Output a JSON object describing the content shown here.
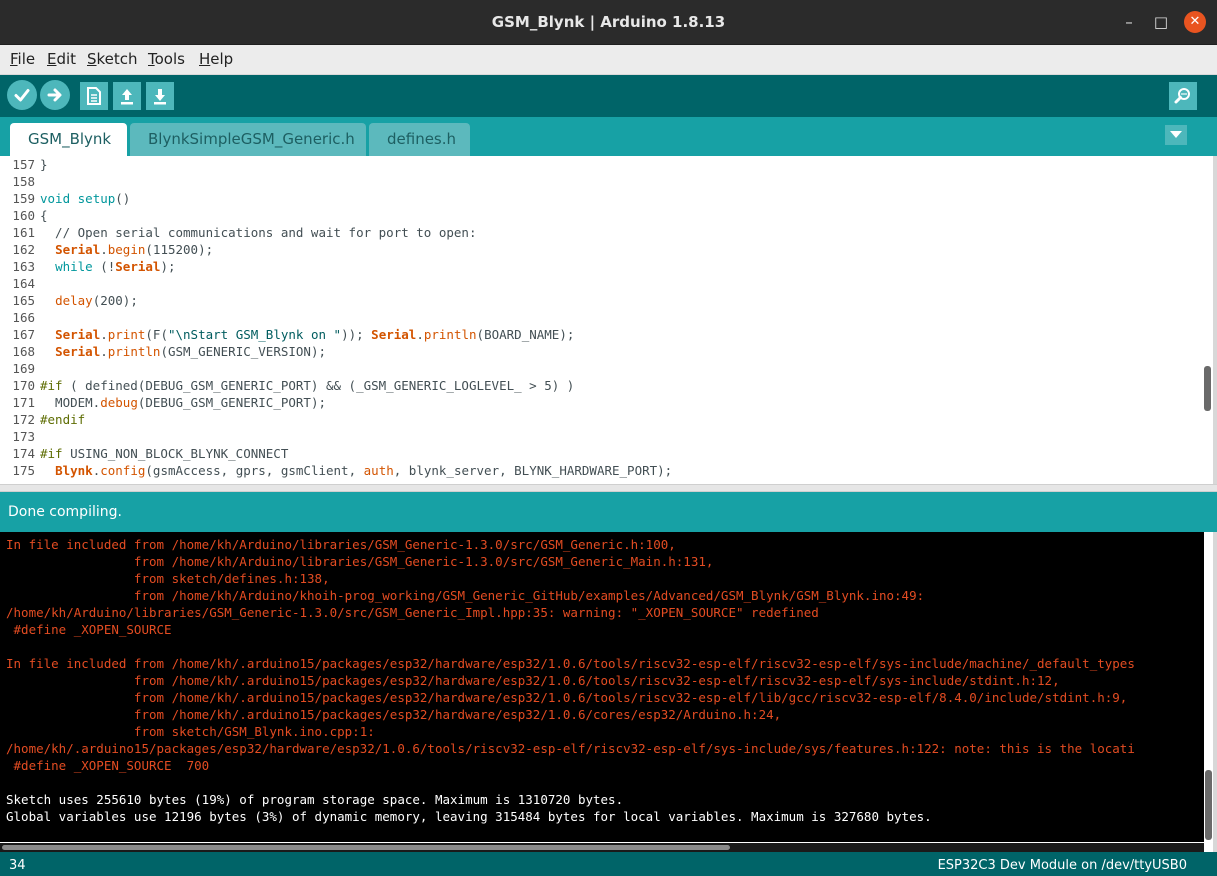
{
  "window": {
    "title": "GSM_Blynk | Arduino 1.8.13",
    "controls": {
      "minimize": "–",
      "maximize": "□",
      "close": "✕"
    }
  },
  "menu": [
    {
      "mnemonic": "F",
      "rest": "ile"
    },
    {
      "mnemonic": "E",
      "rest": "dit"
    },
    {
      "mnemonic": "S",
      "rest": "ketch"
    },
    {
      "mnemonic": "T",
      "rest": "ools"
    },
    {
      "mnemonic": "H",
      "rest": "elp"
    }
  ],
  "toolbar": {
    "buttons": [
      "verify-icon",
      "upload-icon",
      "new-icon",
      "open-icon",
      "save-icon"
    ],
    "right": "serial-monitor-icon"
  },
  "tabs": [
    {
      "label": "GSM_Blynk",
      "active": true
    },
    {
      "label": "BlynkSimpleGSM_Generic.h",
      "active": false
    },
    {
      "label": "defines.h",
      "active": false
    }
  ],
  "editor": {
    "lines": [
      {
        "n": "157",
        "t": "}"
      },
      {
        "n": "158",
        "t": ""
      },
      {
        "n": "159",
        "t": "void setup()"
      },
      {
        "n": "160",
        "t": "{"
      },
      {
        "n": "161",
        "t": "  // Open serial communications and wait for port to open:"
      },
      {
        "n": "162",
        "t": "  Serial.begin(115200);"
      },
      {
        "n": "163",
        "t": "  while (!Serial);"
      },
      {
        "n": "164",
        "t": ""
      },
      {
        "n": "165",
        "t": "  delay(200);"
      },
      {
        "n": "166",
        "t": ""
      },
      {
        "n": "167",
        "t": "  Serial.print(F(\"\\nStart GSM_Blynk on \")); Serial.println(BOARD_NAME);"
      },
      {
        "n": "168",
        "t": "  Serial.println(GSM_GENERIC_VERSION);"
      },
      {
        "n": "169",
        "t": ""
      },
      {
        "n": "170",
        "t": "#if ( defined(DEBUG_GSM_GENERIC_PORT) && (_GSM_GENERIC_LOGLEVEL_ > 5) )"
      },
      {
        "n": "171",
        "t": "  MODEM.debug(DEBUG_GSM_GENERIC_PORT);"
      },
      {
        "n": "172",
        "t": "#endif"
      },
      {
        "n": "173",
        "t": ""
      },
      {
        "n": "174",
        "t": "#if USING_NON_BLOCK_BLYNK_CONNECT"
      },
      {
        "n": "175",
        "t": "  Blynk.config(gsmAccess, gprs, gsmClient, auth, blynk_server, BLYNK_HARDWARE_PORT);"
      }
    ]
  },
  "status": {
    "message": "Done compiling."
  },
  "console": {
    "lines": [
      {
        "t": "In file included from /home/kh/Arduino/libraries/GSM_Generic-1.3.0/src/GSM_Generic.h:100,",
        "kind": "err"
      },
      {
        "t": "                 from /home/kh/Arduino/libraries/GSM_Generic-1.3.0/src/GSM_Generic_Main.h:131,",
        "kind": "err"
      },
      {
        "t": "                 from sketch/defines.h:138,",
        "kind": "err"
      },
      {
        "t": "                 from /home/kh/Arduino/khoih-prog_working/GSM_Generic_GitHub/examples/Advanced/GSM_Blynk/GSM_Blynk.ino:49:",
        "kind": "err"
      },
      {
        "t": "/home/kh/Arduino/libraries/GSM_Generic-1.3.0/src/GSM_Generic_Impl.hpp:35: warning: \"_XOPEN_SOURCE\" redefined",
        "kind": "err"
      },
      {
        "t": " #define _XOPEN_SOURCE",
        "kind": "err"
      },
      {
        "t": "",
        "kind": "err"
      },
      {
        "t": "In file included from /home/kh/.arduino15/packages/esp32/hardware/esp32/1.0.6/tools/riscv32-esp-elf/riscv32-esp-elf/sys-include/machine/_default_types",
        "kind": "err"
      },
      {
        "t": "                 from /home/kh/.arduino15/packages/esp32/hardware/esp32/1.0.6/tools/riscv32-esp-elf/riscv32-esp-elf/sys-include/stdint.h:12,",
        "kind": "err"
      },
      {
        "t": "                 from /home/kh/.arduino15/packages/esp32/hardware/esp32/1.0.6/tools/riscv32-esp-elf/lib/gcc/riscv32-esp-elf/8.4.0/include/stdint.h:9,",
        "kind": "err"
      },
      {
        "t": "                 from /home/kh/.arduino15/packages/esp32/hardware/esp32/1.0.6/cores/esp32/Arduino.h:24,",
        "kind": "err"
      },
      {
        "t": "                 from sketch/GSM_Blynk.ino.cpp:1:",
        "kind": "err"
      },
      {
        "t": "/home/kh/.arduino15/packages/esp32/hardware/esp32/1.0.6/tools/riscv32-esp-elf/riscv32-esp-elf/sys-include/sys/features.h:122: note: this is the locati",
        "kind": "err"
      },
      {
        "t": " #define _XOPEN_SOURCE  700",
        "kind": "err"
      },
      {
        "t": "",
        "kind": "ok"
      },
      {
        "t": "Sketch uses 255610 bytes (19%) of program storage space. Maximum is 1310720 bytes.",
        "kind": "ok"
      },
      {
        "t": "Global variables use 12196 bytes (3%) of dynamic memory, leaving 315484 bytes for local variables. Maximum is 327680 bytes.",
        "kind": "ok"
      }
    ]
  },
  "footer": {
    "line_number": "34",
    "board": "ESP32C3 Dev Module on /dev/ttyUSB0"
  },
  "colors": {
    "toolbar": "#006468",
    "tabbar": "#17a1a5",
    "error_text": "#e34c22"
  }
}
